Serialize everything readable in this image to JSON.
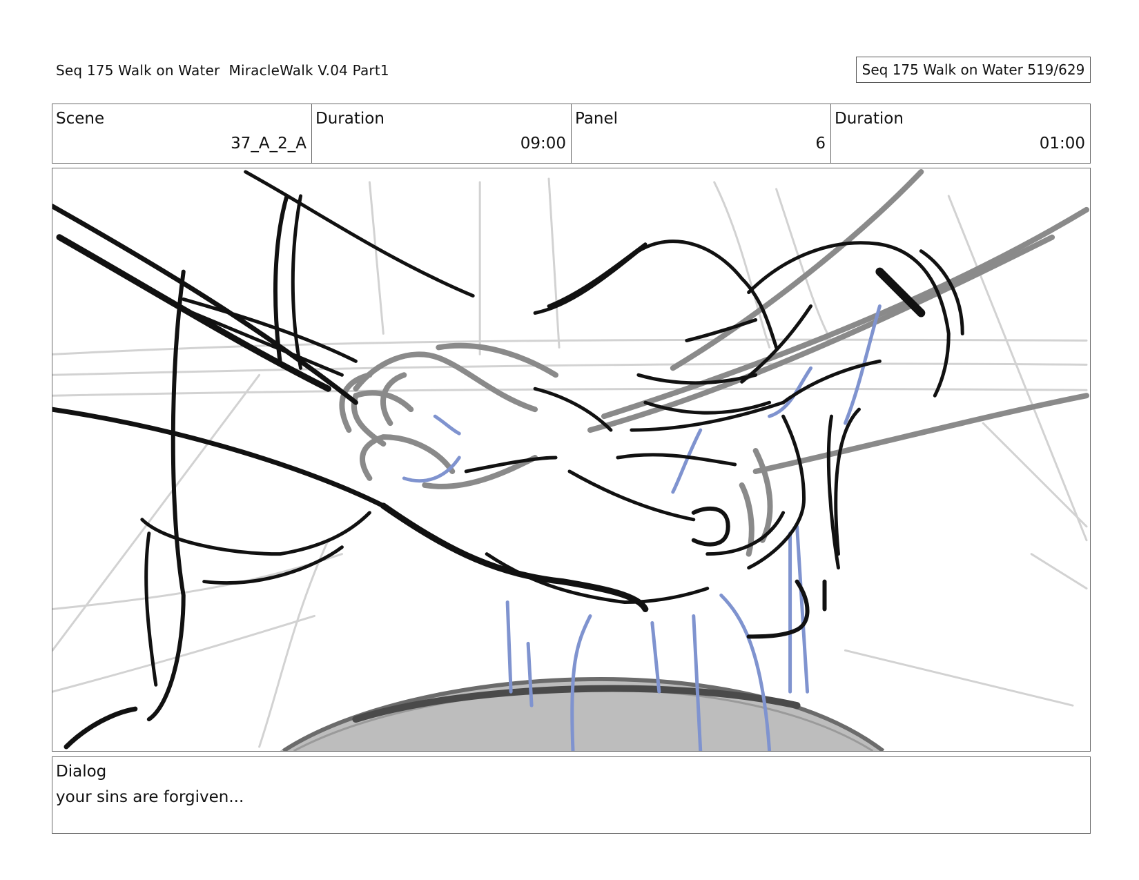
{
  "header": {
    "title": "Seq 175 Walk on Water  MiracleWalk V.04 Part1",
    "page_counter": "Seq 175 Walk on Water 519/629"
  },
  "info": {
    "scene_label": "Scene",
    "scene_value": "37_A_2_A",
    "scene_duration_label": "Duration",
    "scene_duration_value": "09:00",
    "panel_label": "Panel",
    "panel_value": "6",
    "panel_duration_label": "Duration",
    "panel_duration_value": "01:00"
  },
  "dialog": {
    "label": "Dialog",
    "text": "your sins are forgiven..."
  },
  "colors": {
    "ink": "#111111",
    "sketch_gray": "#8a8a8a",
    "water_blue": "#7f93cf",
    "basin_gray": "#bdbdbd"
  }
}
